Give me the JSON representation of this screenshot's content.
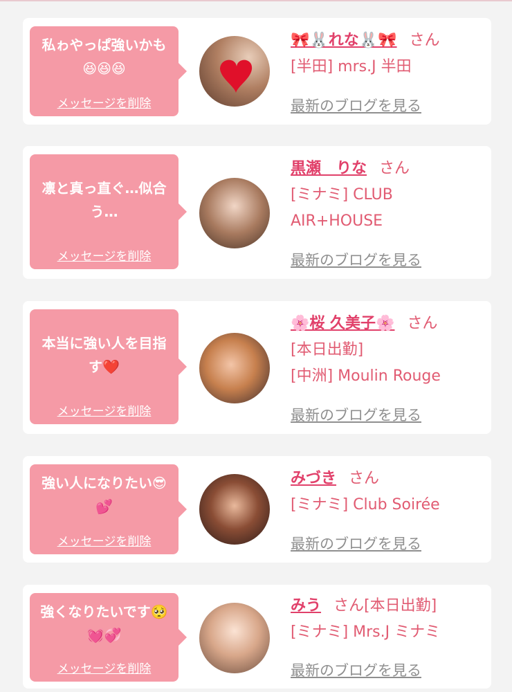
{
  "honorific": "さん",
  "delete_label": "メッセージを削除",
  "blog_label": "最新のブログを見る",
  "colors": {
    "bubble": "#f59aa6",
    "name": "#e1406a",
    "text": "#e15b72",
    "link": "#8f8f8f"
  },
  "cards": [
    {
      "message": "私ゎやっぱ強いかも😆😆😆",
      "name": "🎀🐰れな🐰🎀",
      "suffix": "",
      "lines": [
        "[半田] mrs.J 半田"
      ]
    },
    {
      "message": "凛と真っ直ぐ…似合う…",
      "name": "黒瀬　りな",
      "suffix": "",
      "lines": [
        "[ミナミ] CLUB",
        "AIR+HOUSE"
      ]
    },
    {
      "message": "本当に強い人を目指す❤️",
      "name": "🌸桜 久美子🌸",
      "suffix": "",
      "lines": [
        "[本日出勤]",
        "[中洲] Moulin Rouge"
      ]
    },
    {
      "message": "強い人になりたい😎💕",
      "name": "みづき",
      "suffix": "",
      "lines": [
        "[ミナミ] Club Soirée"
      ]
    },
    {
      "message": "強くなりたいです🥺💓💞",
      "name": "みう",
      "suffix": "[本日出勤]",
      "lines": [
        "[ミナミ] Mrs.J ミナミ"
      ]
    }
  ]
}
